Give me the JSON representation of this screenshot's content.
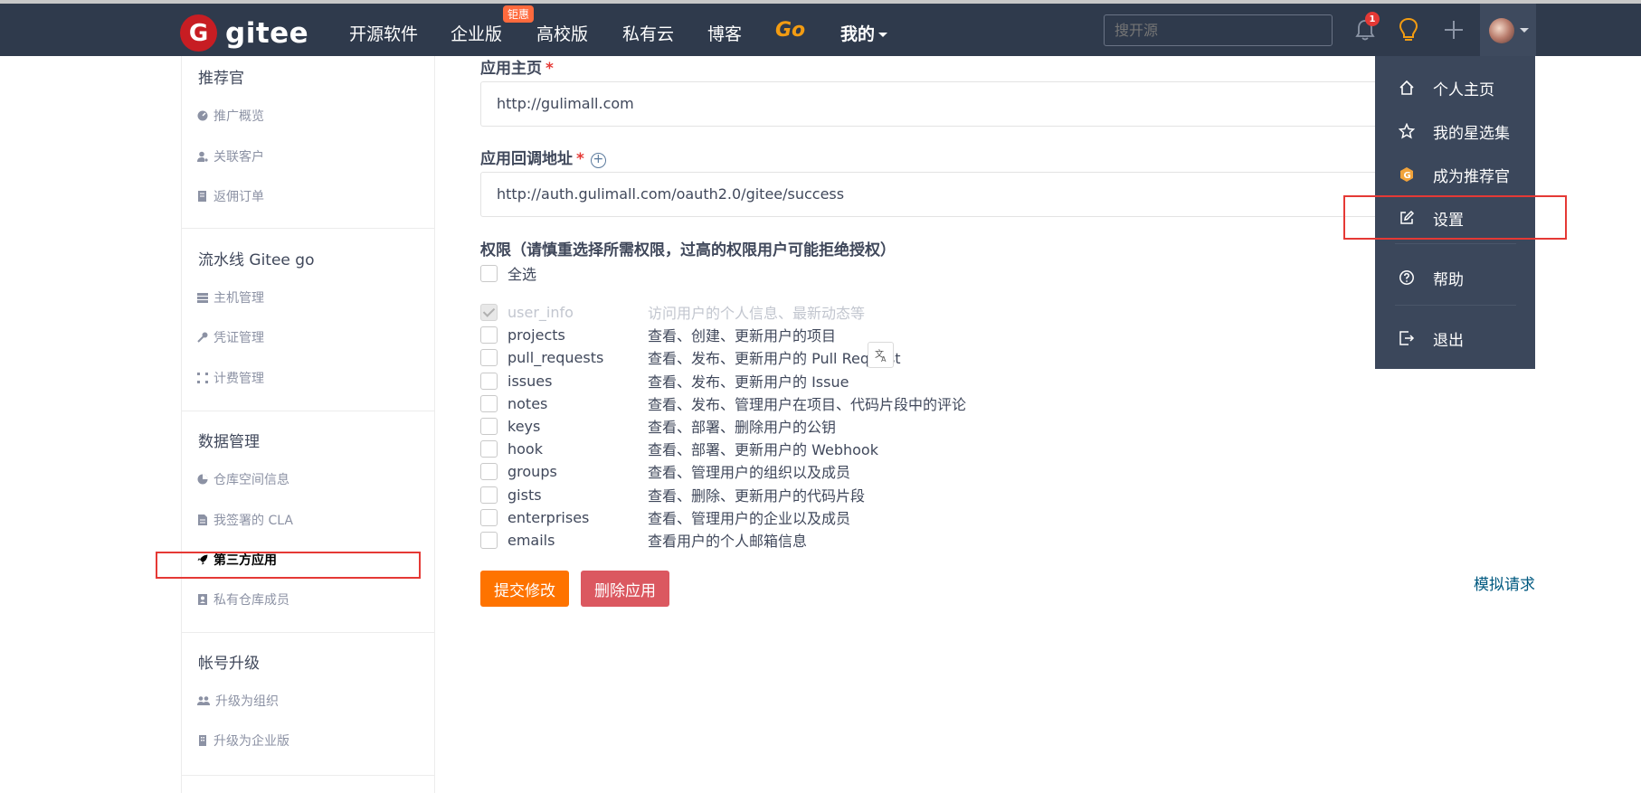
{
  "nav": {
    "logo_letter": "G",
    "logo_text": "gitee",
    "items": [
      "开源软件",
      "企业版",
      "高校版",
      "私有云",
      "博客"
    ],
    "go_label": "Go",
    "mine_label": "我的",
    "enterprise_badge": "钜惠",
    "search_placeholder": "搜开源",
    "notification_count": "1"
  },
  "sidebar": {
    "sections": [
      {
        "title": "推荐官",
        "items": [
          "推广概览",
          "关联客户",
          "返佣订单"
        ]
      },
      {
        "title": "流水线 Gitee go",
        "items": [
          "主机管理",
          "凭证管理",
          "计费管理"
        ]
      },
      {
        "title": "数据管理",
        "items": [
          "仓库空间信息",
          "我签署的 CLA",
          "第三方应用",
          "私有仓库成员"
        ]
      },
      {
        "title": "帐号升级",
        "items": [
          "升级为组织",
          "升级为企业版"
        ]
      }
    ],
    "active_item": "第三方应用"
  },
  "form": {
    "homepage_label": "应用主页",
    "homepage_value": "http://gulimall.com",
    "callback_label": "应用回调地址",
    "callback_value": "http://auth.gulimall.com/oauth2.0/gitee/success",
    "required_mark": "*",
    "add_mark": "+",
    "permissions_label": "权限（请慎重选择所需权限，过高的权限用户可能拒绝授权）",
    "select_all_label": "全选",
    "permissions": [
      {
        "name": "user_info",
        "desc": "访问用户的个人信息、最新动态等",
        "checked": true,
        "disabled": true
      },
      {
        "name": "projects",
        "desc": "查看、创建、更新用户的项目",
        "checked": false
      },
      {
        "name": "pull_requests",
        "desc": "查看、发布、更新用户的 Pull Request",
        "checked": false
      },
      {
        "name": "issues",
        "desc": "查看、发布、更新用户的 Issue",
        "checked": false
      },
      {
        "name": "notes",
        "desc": "查看、发布、管理用户在项目、代码片段中的评论",
        "checked": false
      },
      {
        "name": "keys",
        "desc": "查看、部署、删除用户的公钥",
        "checked": false
      },
      {
        "name": "hook",
        "desc": "查看、部署、更新用户的 Webhook",
        "checked": false
      },
      {
        "name": "groups",
        "desc": "查看、管理用户的组织以及成员",
        "checked": false
      },
      {
        "name": "gists",
        "desc": "查看、删除、更新用户的代码片段",
        "checked": false
      },
      {
        "name": "enterprises",
        "desc": "查看、管理用户的企业以及成员",
        "checked": false
      },
      {
        "name": "emails",
        "desc": "查看用户的个人邮箱信息",
        "checked": false
      }
    ],
    "submit_label": "提交修改",
    "delete_label": "删除应用",
    "simulate_label": "模拟请求"
  },
  "dropdown": {
    "items": [
      "个人主页",
      "我的星选集",
      "成为推荐官",
      "设置",
      "帮助",
      "退出"
    ],
    "recommend_icon_letter": "G"
  },
  "colors": {
    "navbar": "#2f3a4c",
    "brand_red": "#c71d23",
    "submit_orange": "#fe7300",
    "delete_red": "#db5860",
    "highlight_red": "#e53935"
  }
}
